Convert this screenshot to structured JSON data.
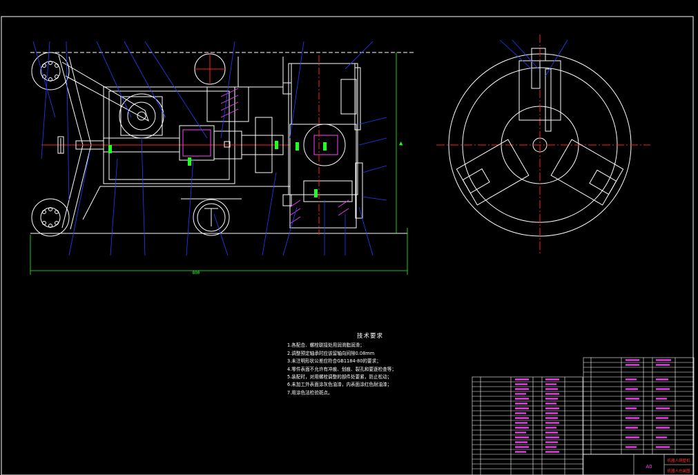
{
  "drawing": {
    "overall_dimension": "800",
    "colors": {
      "background": "#000000",
      "outline": "#ffffff",
      "leader": "#2040ff",
      "centerline": "#ff2020",
      "dimension": "#20ff20",
      "hatch": "#ff40ff",
      "frame": "#ffffff",
      "table_text": "#ff40ff"
    }
  },
  "tech_requirements": {
    "title": "技术要求",
    "lines": [
      "1.各配合、螺栓联接处用润滑脂润滑；",
      "2.调整预定轴承时应该留轴向间隙0.08mm",
      "3.未注明形状公差应符合GB1184-80的要求；",
      "4.零件表面不允许有冲痕、划痕、裂孔和要逐检查等；",
      "5.装配时，对用螺栓调整的部件处要紧，防止松动；",
      "6.未加工外表面涂灰色油漆，内表面涂红色耐油漆；",
      "7.用涂色法检验斑点。"
    ]
  },
  "title_block": {
    "drawing_name": "机器人爬壁机",
    "drawing_code": "机器人总装图",
    "sheet": "A0"
  }
}
